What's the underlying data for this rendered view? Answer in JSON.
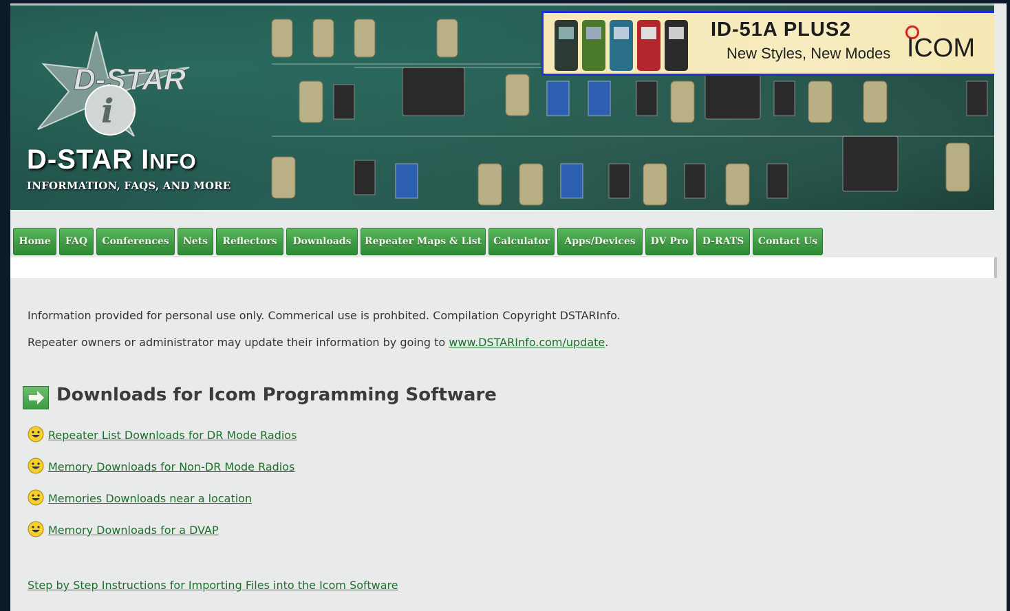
{
  "site": {
    "title_part1": "D-STAR I",
    "title_part2": "NFO",
    "tagline": "INFORMATION, FAQS, AND MORE",
    "logo_text": "D-STAR",
    "logo_badge": "i"
  },
  "ad": {
    "headline": "ID-51A PLUS2",
    "subline": "New Styles, New Modes",
    "brand": "ICOM"
  },
  "nav": {
    "items": [
      {
        "label": "Home"
      },
      {
        "label": "FAQ"
      },
      {
        "label": "Conferences"
      },
      {
        "label": "Nets"
      },
      {
        "label": "Reflectors"
      },
      {
        "label": "Downloads"
      },
      {
        "label": "Repeater Maps & List"
      },
      {
        "label": "Calculator"
      },
      {
        "label": "Apps/Devices"
      },
      {
        "label": "DV Pro"
      },
      {
        "label": "D-RATS"
      },
      {
        "label": "Contact Us"
      }
    ]
  },
  "content": {
    "notice1": "Information provided for personal use only. Commerical use is prohbited. Compilation Copyright DSTARInfo.",
    "notice2_prefix": "Repeater owners or administrator may update their information by going to ",
    "notice2_link": "www.DSTARInfo.com/update",
    "notice2_suffix": ".",
    "section_title": "Downloads for Icom Programming Software",
    "downloads": [
      {
        "label": "Repeater List Downloads for DR Mode Radios"
      },
      {
        "label": "Memory Downloads for Non-DR Mode Radios"
      },
      {
        "label": "Memories Downloads near a location"
      },
      {
        "label": "Memory Downloads for a DVAP"
      }
    ],
    "footer_link": "Step by Step Instructions for Importing Files into the Icom Software"
  },
  "colors": {
    "nav_green": "#3f9c44",
    "link_green": "#1c6f2a",
    "ad_border": "#1f2de0",
    "page_bg": "#e9ebea"
  }
}
